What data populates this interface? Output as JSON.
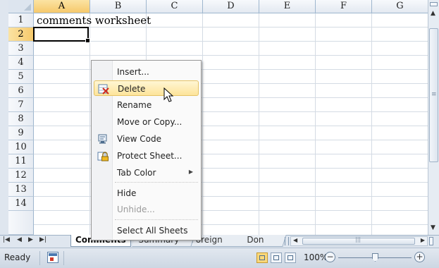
{
  "grid": {
    "columns": [
      "A",
      "B",
      "C",
      "D",
      "E",
      "F",
      "G"
    ],
    "rows": [
      "1",
      "2",
      "3",
      "4",
      "5",
      "6",
      "7",
      "8",
      "9",
      "10",
      "11",
      "12",
      "13",
      "14"
    ],
    "selected_column": "A",
    "selected_row": "2",
    "cell_A1": "comments worksheet"
  },
  "context_menu": {
    "items": [
      {
        "label": "Insert...",
        "icon": "",
        "state": "normal"
      },
      {
        "label": "Delete",
        "icon": "delete-sheet-icon",
        "state": "highlighted"
      },
      {
        "label": "Rename",
        "icon": "",
        "state": "normal"
      },
      {
        "label": "Move or Copy...",
        "icon": "",
        "state": "normal"
      },
      {
        "label": "View Code",
        "icon": "view-code-icon",
        "state": "normal"
      },
      {
        "label": "Protect Sheet...",
        "icon": "protect-sheet-icon",
        "state": "normal"
      },
      {
        "label": "Tab Color",
        "icon": "",
        "state": "normal",
        "submenu": true
      },
      {
        "label": "Hide",
        "icon": "",
        "state": "normal"
      },
      {
        "label": "Unhide...",
        "icon": "",
        "state": "disabled"
      },
      {
        "label": "Select All Sheets",
        "icon": "",
        "state": "normal"
      }
    ]
  },
  "sheet_tabs": {
    "tabs": [
      "Comments",
      "Summary",
      "Foreign",
      "Don"
    ],
    "active": "Comments"
  },
  "status_bar": {
    "ready": "Ready",
    "zoom": "100%",
    "zoom_out": "−",
    "zoom_in": "+"
  },
  "colors": {
    "header_selected": "#f6c96b",
    "menu_highlight": "#fde49a",
    "grid_line": "#d4dbe4"
  }
}
